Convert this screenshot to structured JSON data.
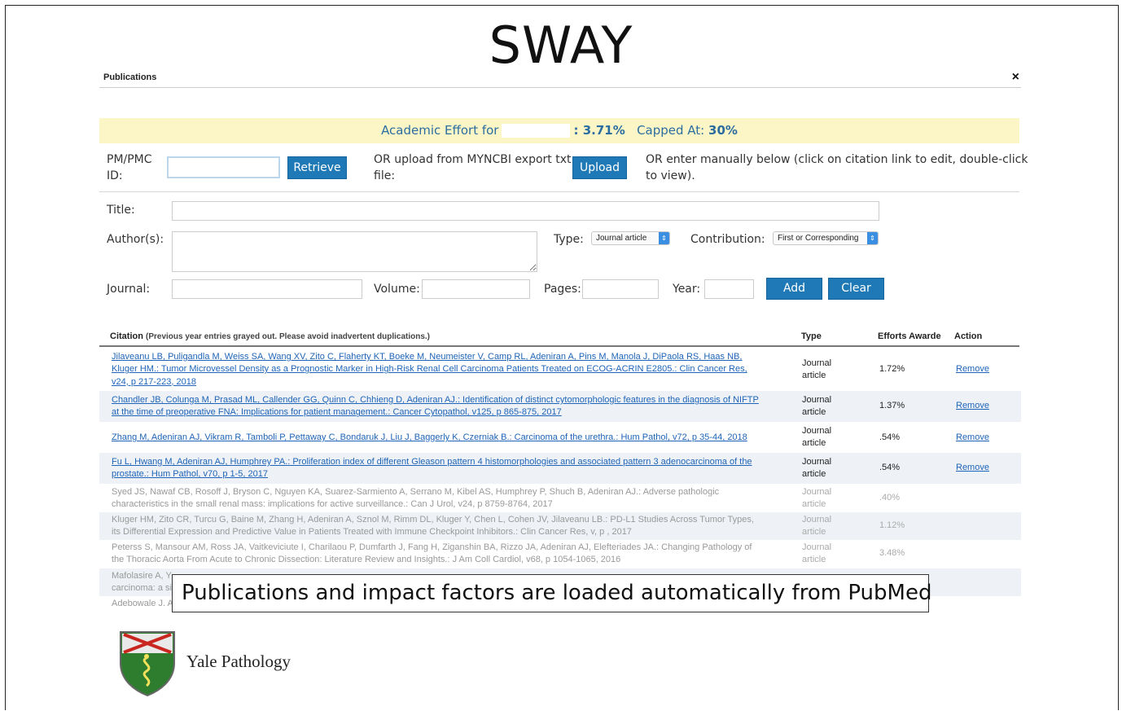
{
  "slide_title": "SWAY",
  "window": {
    "title": "Publications",
    "close_glyph": "×"
  },
  "effort": {
    "prefix": "Academic Effort for",
    "value": ": 3.71%",
    "capped_label": "Capped At:",
    "capped_value": "30%"
  },
  "retrieve": {
    "label_line1": "PM/PMC",
    "label_line2": "ID:",
    "input_value": "",
    "button": "Retrieve"
  },
  "upload": {
    "label_line1": "OR upload from MYNCBI export txt",
    "label_line2": "file:",
    "button": "Upload"
  },
  "manual": {
    "line1": "OR enter manually below (click on citation link to edit, double-click",
    "line2": "to view)."
  },
  "form": {
    "title_label": "Title:",
    "title_value": "",
    "authors_label": "Author(s):",
    "authors_value": "",
    "type_label": "Type:",
    "type_value": "Journal article",
    "contribution_label": "Contribution:",
    "contribution_value": "First or Corresponding",
    "journal_label": "Journal:",
    "journal_value": "",
    "volume_label": "Volume:",
    "volume_value": "",
    "pages_label": "Pages:",
    "pages_value": "",
    "year_label": "Year:",
    "year_value": "",
    "add_button": "Add",
    "clear_button": "Clear"
  },
  "table": {
    "headers": {
      "citation": "Citation",
      "citation_note": "(Previous year entries grayed out. Please avoid inadvertent duplications.)",
      "type": "Type",
      "efforts": "Efforts Awarde",
      "action": "Action"
    },
    "rows": [
      {
        "lines": [
          "Jilaveanu LB, Puligandla M, Weiss SA, Wang XV, Zito C, Flaherty KT, Boeke M, Neumeister V, Camp RL, Adeniran A, Pins M, Manola J, DiPaola RS, Haas NB,",
          "Kluger HM.: Tumor Microvessel Density as a Prognostic Marker in High-Risk Renal Cell Carcinoma Patients Treated on ECOG-ACRIN E2805.: Clin Cancer Res,",
          "v24, p 217-223, 2018"
        ],
        "type": [
          "Journal",
          "article"
        ],
        "effort": "1.72%",
        "action": "Remove"
      },
      {
        "lines": [
          "Chandler JB, Colunga M, Prasad ML, Callender GG, Quinn C, Chhieng D, Adeniran AJ.: Identification of distinct cytomorphologic features in the diagnosis of NIFTP",
          "at the time of preoperative FNA: Implications for patient management.: Cancer Cytopathol, v125, p 865-875, 2017"
        ],
        "type": [
          "Journal",
          "article"
        ],
        "effort": "1.37%",
        "action": "Remove"
      },
      {
        "lines": [
          "Zhang M, Adeniran AJ, Vikram R, Tamboli P, Pettaway C, Bondaruk J, Liu J, Baggerly K, Czerniak B.: Carcinoma of the urethra.: Hum Pathol, v72, p 35-44, 2018"
        ],
        "type": [
          "Journal",
          "article"
        ],
        "effort": ".54%",
        "action": "Remove"
      },
      {
        "lines": [
          "Fu L, Hwang M, Adeniran AJ, Humphrey PA.: Proliferation index of different Gleason pattern 4 histomorphologies and associated pattern 3 adenocarcinoma of the",
          "prostate.: Hum Pathol, v70, p 1-5, 2017"
        ],
        "type": [
          "Journal",
          "article"
        ],
        "effort": ".54%",
        "action": "Remove"
      },
      {
        "lines": [
          "Syed JS, Nawaf CB, Rosoff J, Bryson C, Nguyen KA, Suarez-Sarmiento A, Serrano M, Kibel AS, Humphrey P, Shuch B, Adeniran AJ.: Adverse pathologic",
          "characteristics in the small renal mass: implications for active surveillance.: Can J Urol, v24, p 8759-8764, 2017"
        ],
        "type": [
          "Journal",
          "article"
        ],
        "effort": ".40%",
        "action": ""
      },
      {
        "lines": [
          "Kluger HM, Zito CR, Turcu G, Baine M, Zhang H, Adeniran A, Sznol M, Rimm DL, Kluger Y, Chen L, Cohen JV, Jilaveanu LB.: PD-L1 Studies Across Tumor Types,",
          "its Differential Expression and Predictive Value in Patients Treated with Immune Checkpoint Inhibitors.: Clin Cancer Res, v, p , 2017"
        ],
        "type": [
          "Journal",
          "article"
        ],
        "effort": "1.12%",
        "action": ""
      },
      {
        "lines": [
          "Peterss S, Mansour AM, Ross JA, Vaitkeviciute I, Charilaou P, Dumfarth J, Fang H, Ziganshin BA, Rizzo JA, Adeniran AJ, Elefteriades JA.: Changing Pathology of",
          "the Thoracic Aorta From Acute to Chronic Dissection: Literature Review and Insights.: J Am Coll Cardiol, v68, p 1054-1065, 2016"
        ],
        "type": [
          "Journal",
          "article"
        ],
        "effort": "3.48%",
        "action": ""
      },
      {
        "lines": [
          "Mafolasire A, Y",
          "carcinoma: a si"
        ],
        "type": [
          "",
          ""
        ],
        "effort": "",
        "action": ""
      },
      {
        "lines": [
          "Adebowale J. A"
        ],
        "type": [
          ""
        ],
        "effort": "",
        "action": ""
      }
    ]
  },
  "callout": "Publications and impact factors are loaded automatically from PubMed",
  "branding": {
    "name": "Yale Pathology"
  },
  "colors": {
    "accent_blue": "#1f79b6",
    "link_blue": "#1e64b8",
    "banner_yellow": "#fcf6c7",
    "shield_green": "#2e7d2e",
    "cross_red": "#c8261e"
  }
}
